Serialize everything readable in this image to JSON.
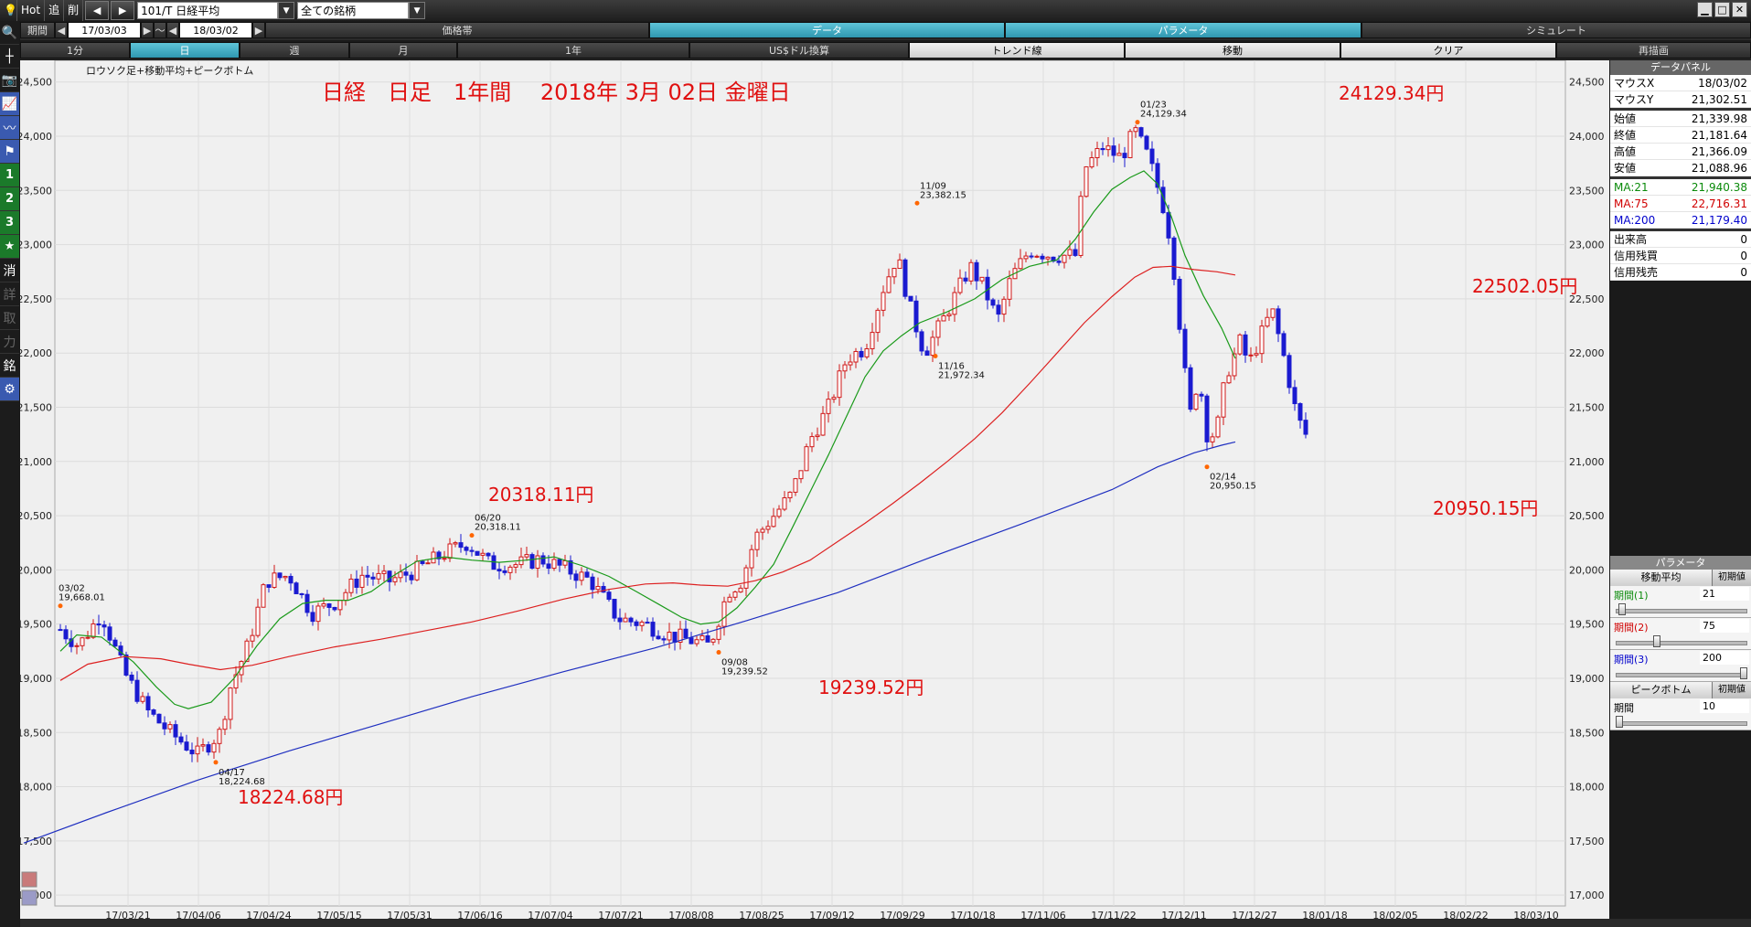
{
  "topbar": {
    "hot": "Hot",
    "add": "追",
    "del": "削",
    "prev_icon": "left-arrow-icon",
    "next_icon": "right-arrow-icon",
    "symbol": "101/T 日経平均",
    "universe": "全ての銘柄"
  },
  "toolbar": {
    "period_label": "期間",
    "from": "17/03/03",
    "tilde": "～",
    "to": "18/03/02",
    "tabs": [
      "価格帯",
      "データ",
      "パラメータ",
      "シミュレート"
    ],
    "active_tabs": [
      1,
      2
    ]
  },
  "timeframes": {
    "items": [
      "1分",
      "日",
      "週",
      "月",
      "1年",
      "US$ドル換算",
      "トレンド線",
      "移動",
      "クリア",
      "再描画"
    ],
    "active": "日"
  },
  "left_tools": [
    {
      "icon": "search-icon",
      "glyph": "🔍"
    },
    {
      "icon": "crosshair-icon",
      "glyph": "┼"
    },
    {
      "icon": "camera-icon",
      "glyph": "📷"
    },
    {
      "icon": "line-chart-icon",
      "glyph": "📈"
    },
    {
      "icon": "line-chart-2-icon",
      "glyph": "〰"
    },
    {
      "icon": "flag-icon",
      "glyph": "⚑"
    },
    {
      "label": "1"
    },
    {
      "label": "2"
    },
    {
      "label": "3"
    },
    {
      "icon": "star-icon",
      "glyph": "★"
    },
    {
      "label": "消"
    },
    {
      "label": "詳"
    },
    {
      "label": "取"
    },
    {
      "label": "力"
    },
    {
      "label": "銘"
    },
    {
      "icon": "gear-icon",
      "glyph": "⚙"
    }
  ],
  "data_panel": {
    "title": "データパネル",
    "rows": [
      {
        "k": "マウスX",
        "v": "18/03/02"
      },
      {
        "k": "マウスY",
        "v": "21,302.51"
      },
      {
        "k": "始値",
        "v": "21,339.98"
      },
      {
        "k": "終値",
        "v": "21,181.64"
      },
      {
        "k": "高値",
        "v": "21,366.09"
      },
      {
        "k": "安値",
        "v": "21,088.96"
      },
      {
        "k": "MA:21",
        "v": "21,940.38",
        "c": "green"
      },
      {
        "k": "MA:75",
        "v": "22,716.31",
        "c": "red"
      },
      {
        "k": "MA:200",
        "v": "21,179.40",
        "c": "blue"
      },
      {
        "k": "出来高",
        "v": "0"
      },
      {
        "k": "信用残買",
        "v": "0"
      },
      {
        "k": "信用残売",
        "v": "0"
      }
    ]
  },
  "param_panel": {
    "title": "パラメータ",
    "ma_section": "移動平均",
    "reset": "初期値",
    "periods": [
      {
        "name": "期間(1)",
        "value": "21",
        "c": "green",
        "level": 0.02
      },
      {
        "name": "期間(2)",
        "value": "75",
        "c": "red",
        "level": 0.3
      },
      {
        "name": "期間(3)",
        "value": "200",
        "c": "blue",
        "level": 1.0
      }
    ],
    "peak_section": "ピークボトム",
    "peak_reset": "初期値",
    "peak_period": {
      "name": "期間",
      "value": "10",
      "level": 0.0
    }
  },
  "chart_data": {
    "type": "candlestick",
    "subtitle": "ロウソク足+移動平均+ピークボトム",
    "title": "日経　日足　1年間　 2018年 3月 02日 金曜日",
    "ylim": [
      16900,
      24700
    ],
    "yticks": [
      17000,
      17500,
      18000,
      18500,
      19000,
      19500,
      20000,
      20500,
      21000,
      21500,
      22000,
      22500,
      23000,
      23500,
      24000,
      24500
    ],
    "xticks": [
      "17/03/21",
      "17/04/06",
      "17/04/24",
      "17/05/15",
      "17/05/31",
      "17/06/16",
      "17/07/04",
      "17/07/21",
      "17/08/08",
      "17/08/25",
      "17/09/12",
      "17/09/29",
      "17/10/18",
      "17/11/06",
      "17/11/22",
      "17/12/11",
      "17/12/27",
      "18/01/18",
      "18/02/05",
      "18/02/22",
      "18/03/10"
    ],
    "peaks": [
      {
        "date": "03/02",
        "value": "19,668.01"
      },
      {
        "date": "04/17",
        "value": "18,224.68"
      },
      {
        "date": "06/20",
        "value": "20,318.11"
      },
      {
        "date": "09/08",
        "value": "19,239.52"
      },
      {
        "date": "11/09",
        "value": "23,382.15"
      },
      {
        "date": "11/16",
        "value": "21,972.34"
      },
      {
        "date": "01/23",
        "value": "24,129.34"
      },
      {
        "date": "02/14",
        "value": "20,950.15"
      }
    ],
    "annotations": [
      {
        "text": "24129.34円"
      },
      {
        "text": "22502.05円"
      },
      {
        "text": "20318.11円"
      },
      {
        "text": "19239.52円"
      },
      {
        "text": "18224.68円"
      },
      {
        "text": "20950.15円"
      }
    ],
    "series": [
      {
        "name": "MA:21",
        "color": "#1a9a1a",
        "values": [
          [
            0,
            19250
          ],
          [
            18,
            19400
          ],
          [
            45,
            19380
          ],
          [
            80,
            19150
          ],
          [
            105,
            18920
          ],
          [
            125,
            18760
          ],
          [
            140,
            18720
          ],
          [
            165,
            18780
          ],
          [
            190,
            19000
          ],
          [
            215,
            19300
          ],
          [
            240,
            19550
          ],
          [
            265,
            19690
          ],
          [
            290,
            19720
          ],
          [
            315,
            19720
          ],
          [
            340,
            19800
          ],
          [
            365,
            19950
          ],
          [
            390,
            20080
          ],
          [
            420,
            20120
          ],
          [
            450,
            20090
          ],
          [
            480,
            20070
          ],
          [
            510,
            20090
          ],
          [
            540,
            20120
          ],
          [
            570,
            20040
          ],
          [
            600,
            19940
          ],
          [
            630,
            19800
          ],
          [
            655,
            19680
          ],
          [
            680,
            19560
          ],
          [
            700,
            19500
          ],
          [
            720,
            19520
          ],
          [
            740,
            19650
          ],
          [
            760,
            19840
          ],
          [
            780,
            20050
          ],
          [
            800,
            20380
          ],
          [
            820,
            20720
          ],
          [
            840,
            21060
          ],
          [
            860,
            21420
          ],
          [
            880,
            21780
          ],
          [
            900,
            22020
          ],
          [
            920,
            22160
          ],
          [
            940,
            22280
          ],
          [
            970,
            22380
          ],
          [
            1000,
            22500
          ],
          [
            1030,
            22680
          ],
          [
            1060,
            22800
          ],
          [
            1090,
            22860
          ],
          [
            1110,
            23050
          ],
          [
            1130,
            23300
          ],
          [
            1150,
            23510
          ],
          [
            1170,
            23620
          ],
          [
            1185,
            23680
          ],
          [
            1200,
            23560
          ],
          [
            1215,
            23260
          ],
          [
            1230,
            22900
          ],
          [
            1250,
            22530
          ],
          [
            1270,
            22230
          ],
          [
            1285,
            21950
          ]
        ]
      },
      {
        "name": "MA:75",
        "color": "#dd2020",
        "values": [
          [
            0,
            18980
          ],
          [
            30,
            19130
          ],
          [
            70,
            19200
          ],
          [
            110,
            19180
          ],
          [
            140,
            19130
          ],
          [
            175,
            19080
          ],
          [
            210,
            19120
          ],
          [
            250,
            19200
          ],
          [
            300,
            19290
          ],
          [
            350,
            19360
          ],
          [
            400,
            19440
          ],
          [
            450,
            19520
          ],
          [
            500,
            19620
          ],
          [
            550,
            19730
          ],
          [
            600,
            19820
          ],
          [
            640,
            19870
          ],
          [
            670,
            19880
          ],
          [
            700,
            19860
          ],
          [
            730,
            19850
          ],
          [
            760,
            19900
          ],
          [
            790,
            19980
          ],
          [
            820,
            20090
          ],
          [
            850,
            20260
          ],
          [
            880,
            20430
          ],
          [
            910,
            20610
          ],
          [
            940,
            20800
          ],
          [
            970,
            21000
          ],
          [
            1000,
            21210
          ],
          [
            1030,
            21450
          ],
          [
            1060,
            21720
          ],
          [
            1090,
            22000
          ],
          [
            1120,
            22280
          ],
          [
            1150,
            22520
          ],
          [
            1175,
            22700
          ],
          [
            1195,
            22790
          ],
          [
            1215,
            22800
          ],
          [
            1240,
            22770
          ],
          [
            1265,
            22750
          ],
          [
            1285,
            22720
          ]
        ]
      },
      {
        "name": "MA:200",
        "color": "#1f2fc0",
        "values": [
          [
            -40,
            17480
          ],
          [
            50,
            17760
          ],
          [
            150,
            18060
          ],
          [
            250,
            18330
          ],
          [
            350,
            18580
          ],
          [
            450,
            18830
          ],
          [
            550,
            19060
          ],
          [
            650,
            19280
          ],
          [
            750,
            19530
          ],
          [
            850,
            19790
          ],
          [
            950,
            20110
          ],
          [
            1050,
            20420
          ],
          [
            1150,
            20740
          ],
          [
            1200,
            20950
          ],
          [
            1240,
            21080
          ],
          [
            1270,
            21150
          ],
          [
            1285,
            21180
          ]
        ]
      }
    ]
  }
}
